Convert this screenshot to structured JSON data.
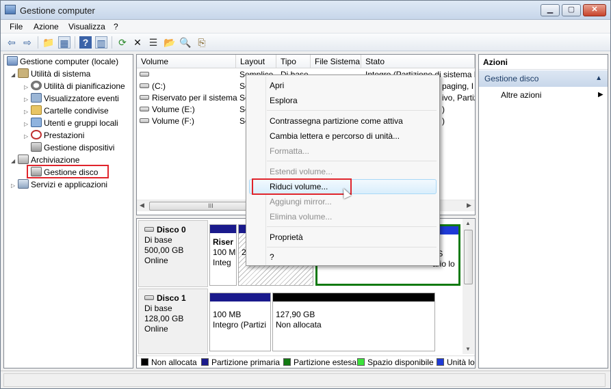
{
  "window": {
    "title": "Gestione computer",
    "controls": [
      "▁",
      "▢",
      "✕"
    ]
  },
  "menu": [
    "File",
    "Azione",
    "Visualizza",
    "?"
  ],
  "toolbar": {
    "icons": [
      "back-arrow-icon",
      "forward-arrow-icon",
      "up-folder-icon",
      "show-hide-tree-icon",
      "help-icon",
      "action-pane-icon",
      "refresh-icon",
      "delete-icon",
      "properties-icon",
      "open-icon",
      "search-icon",
      "export-icon"
    ],
    "glyphs": [
      "⇦",
      "⇨",
      "📁",
      "▦",
      "?",
      "▥",
      "⟳",
      "✕",
      "☰",
      "📂",
      "🔍",
      "⎘"
    ]
  },
  "tree": {
    "root": "Gestione computer (locale)",
    "system_tools": "Utilità di sistema",
    "task_scheduler": "Utilità di pianificazione",
    "event_viewer": "Visualizzatore eventi",
    "shared_folders": "Cartelle condivise",
    "local_users": "Utenti e gruppi locali",
    "performance": "Prestazioni",
    "device_manager": "Gestione dispositivi",
    "storage": "Archiviazione",
    "disk_management": "Gestione disco",
    "services": "Servizi e applicazioni"
  },
  "volumes": {
    "headers": [
      "Volume",
      "Layout",
      "Tipo",
      "File Sistema",
      "Stato"
    ],
    "rows": [
      {
        "volume": "",
        "layout": "Semplice",
        "tipo": "Di base",
        "fs": "",
        "stato": "Integro (Partizione di sistema EFI)"
      },
      {
        "volume": "(C:)",
        "layout": "Se",
        "tipo": "",
        "fs": "",
        "stato": "paging, I"
      },
      {
        "volume": "Riservato per il sistema",
        "layout": "Se",
        "tipo": "",
        "fs": "",
        "stato": "ivo, Partiz"
      },
      {
        "volume": "Volume (E:)",
        "layout": "Se",
        "tipo": "",
        "fs": "",
        "stato": ")"
      },
      {
        "volume": "Volume (F:)",
        "layout": "Se",
        "tipo": "",
        "fs": "",
        "stato": ")"
      }
    ],
    "scroll_grip": "III"
  },
  "disks": [
    {
      "name": "Disco 0",
      "type": "Di base",
      "size": "500,00 GB",
      "status": "Online",
      "partitions": [
        {
          "line1": "Riser",
          "line2": "100 M",
          "line3": "Integ"
        },
        {
          "line1": "",
          "line2": "2",
          "line3": ""
        },
        {
          "line1": "",
          "line2": "FS",
          "line3": "ario lo"
        }
      ]
    },
    {
      "name": "Disco 1",
      "type": "Di base",
      "size": "128,00 GB",
      "status": "Online",
      "partitions": [
        {
          "line1": "100 MB",
          "line2": "Integro (Partizi"
        },
        {
          "line1": "127,90 GB",
          "line2": "Non allocata"
        }
      ]
    }
  ],
  "legend": [
    {
      "label": "Non allocata",
      "color": "#000000"
    },
    {
      "label": "Partizione primaria",
      "color": "#1a1a8c"
    },
    {
      "label": "Partizione estesa",
      "color": "#127a12"
    },
    {
      "label": "Spazio disponibile",
      "color": "#3ce23c"
    },
    {
      "label": "Unità lo",
      "color": "#1e3ad6"
    }
  ],
  "actions": {
    "title": "Azioni",
    "section": "Gestione disco",
    "more": "Altre azioni",
    "collapse_glyph": "▲",
    "more_glyph": "▶"
  },
  "context_menu": {
    "open": "Apri",
    "explore": "Esplora",
    "mark_active": "Contrassegna partizione come attiva",
    "change_letter": "Cambia lettera e percorso di unità...",
    "format": "Formatta...",
    "extend": "Estendi volume...",
    "shrink": "Riduci volume...",
    "add_mirror": "Aggiungi mirror...",
    "delete": "Elimina volume...",
    "properties": "Proprietà",
    "help": "?"
  },
  "colors": {
    "highlight_red": "#e0242b",
    "primary_blue": "#1a1a8c",
    "extended_green": "#127a12"
  }
}
